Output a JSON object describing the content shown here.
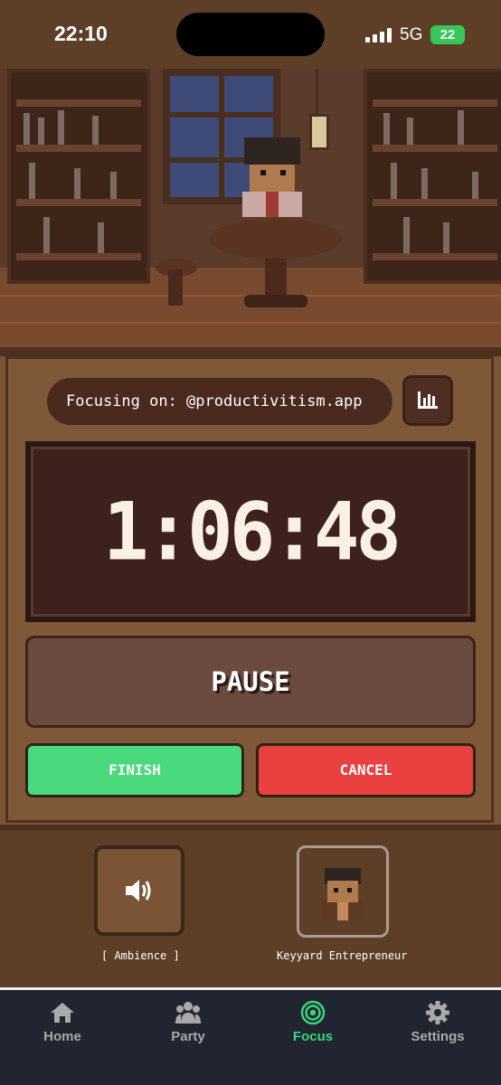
{
  "status_bar": {
    "time": "22:10",
    "network": "5G",
    "battery": "22"
  },
  "focus": {
    "focusing_on": "Focusing on: @productivitism.app",
    "timer": "1:06:48",
    "pause_label": "PAUSE",
    "finish_label": "FINISH",
    "cancel_label": "CANCEL"
  },
  "widgets": {
    "ambience_label": "[ Ambience ]",
    "avatar_label": "Keyyard Entrepreneur"
  },
  "tabs": [
    {
      "label": "Home",
      "icon": "home-icon"
    },
    {
      "label": "Party",
      "icon": "party-icon"
    },
    {
      "label": "Focus",
      "icon": "focus-icon",
      "active": true
    },
    {
      "label": "Settings",
      "icon": "gear-icon"
    }
  ],
  "colors": {
    "finish": "#4ad97c",
    "cancel": "#ea4040",
    "active_tab": "#3bd57a"
  }
}
